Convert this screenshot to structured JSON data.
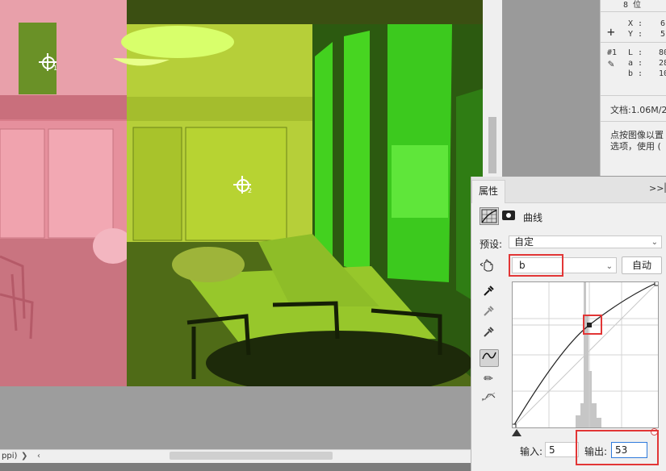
{
  "canvas": {
    "sampler_1": "1",
    "sampler_2": "2"
  },
  "status_bar": {
    "zoom_text": "ppi)"
  },
  "info_panel": {
    "bit_depth": "8 位",
    "x_label": "X :",
    "x_value": "6",
    "y_label": "Y :",
    "y_value": "5",
    "sampler_label": "#1",
    "l_label": "L :",
    "l_value": "80",
    "a_label": "a :",
    "a_value": "28",
    "b_label": "b :",
    "b_value": "10",
    "doc_text": "文档:1.06M/2",
    "hint_line1": "点按图像以置",
    "hint_line2": "选项，使用 ("
  },
  "properties": {
    "tab_label": "属性",
    "menu_glyph": ">>",
    "panel_title": "曲线",
    "preset_label": "预设:",
    "preset_value": "自定",
    "channel_value": "b",
    "auto_button": "自动",
    "input_label": "输入:",
    "input_value": "5",
    "output_label": "输出:",
    "output_value": "53"
  },
  "colors": {
    "highlight": "#e23636",
    "green_overlay": "#5fd62f",
    "pink_overlay": "#e8838f"
  }
}
